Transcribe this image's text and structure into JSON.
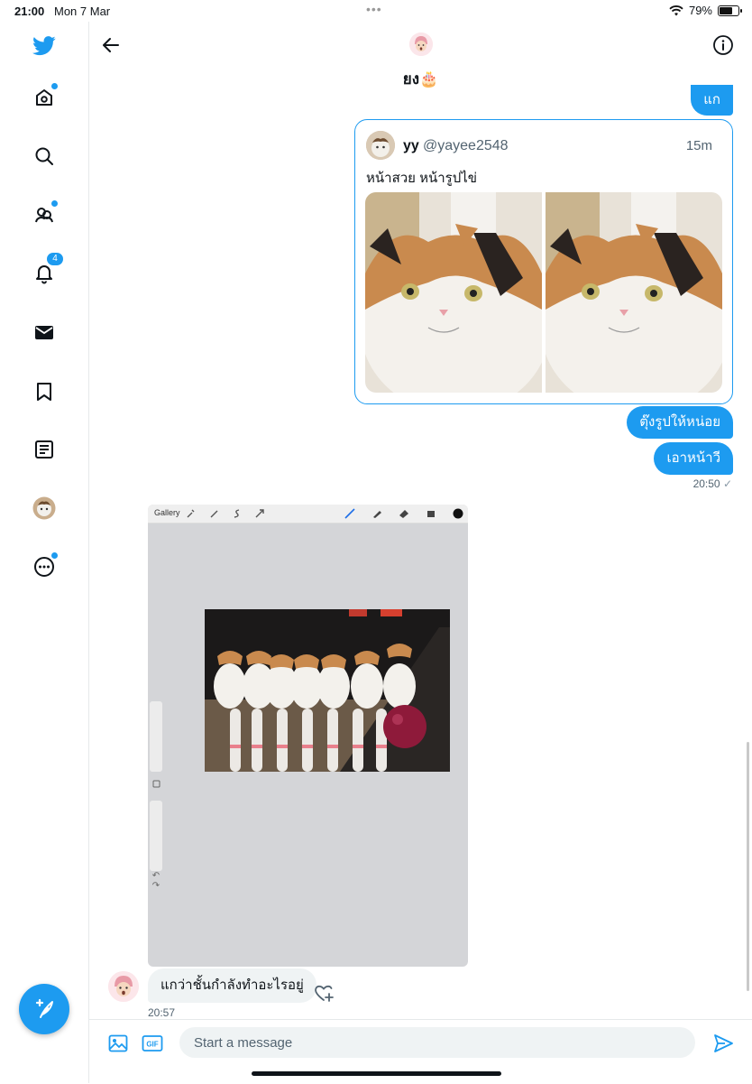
{
  "status_bar": {
    "time": "21:00",
    "date": "Mon 7 Mar",
    "battery": "79%",
    "battery_level": 0.79
  },
  "sidebar": {
    "items": [
      {
        "name": "home-icon",
        "dot": true
      },
      {
        "name": "explore-icon",
        "dot": false
      },
      {
        "name": "communities-icon",
        "dot": true
      },
      {
        "name": "notifications-icon",
        "badge": "4"
      },
      {
        "name": "messages-icon",
        "dot": false
      },
      {
        "name": "bookmarks-icon",
        "dot": false
      },
      {
        "name": "lists-icon",
        "dot": false
      },
      {
        "name": "profile-avatar",
        "dot": false
      },
      {
        "name": "more-icon",
        "dot": true
      }
    ],
    "compose": "compose-tweet"
  },
  "header": {
    "title": "ยง🎂"
  },
  "messages": {
    "out_top": "แก",
    "tweet": {
      "name": "yy",
      "handle": "@yayee2548",
      "time": "15m",
      "text": "หน้าสวย หน้ารูปไข่"
    },
    "out_1": "ตุ๊งรูปให้หน่อย",
    "out_2": "เอาหน้าวี",
    "out_time": "20:50",
    "procreate": {
      "gallery_label": "Gallery"
    },
    "in_1": "แกว่าชั้นกำลังทำอะไรอยู่",
    "in_time": "20:57"
  },
  "composer": {
    "placeholder": "Start a message",
    "gif_label": "GIF"
  },
  "colors": {
    "accent": "#1d9bf0",
    "bubble_in": "#eff3f4"
  }
}
